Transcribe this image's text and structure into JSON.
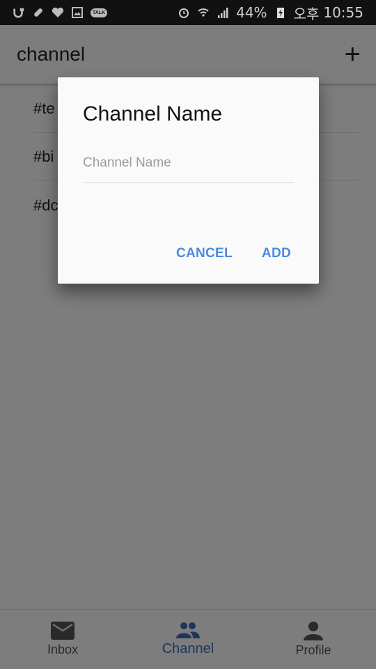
{
  "status_bar": {
    "battery": "44%",
    "time_period": "오후",
    "time": "10:55",
    "left_icons": [
      "u-plus-icon",
      "pill-icon",
      "heart-icon",
      "gallery-icon",
      "kakaotalk-icon"
    ],
    "kakaotalk_label": "TALK",
    "right_icons": [
      "alarm-icon",
      "wifi-icon",
      "signal-icon",
      "battery-charging-icon"
    ]
  },
  "appbar": {
    "title": "channel",
    "add_icon": "+"
  },
  "channels": [
    {
      "label": "#te"
    },
    {
      "label": "#bi"
    },
    {
      "label": "#dc"
    }
  ],
  "dialog": {
    "title": "Channel Name",
    "input_value": "",
    "input_placeholder": "Channel Name",
    "cancel_label": "CANCEL",
    "add_label": "ADD",
    "accent_color": "#4a8ae0"
  },
  "bottom_nav": {
    "items": [
      {
        "label": "Inbox",
        "icon": "mail-icon",
        "active": false
      },
      {
        "label": "Channel",
        "icon": "group-icon",
        "active": true
      },
      {
        "label": "Profile",
        "icon": "person-icon",
        "active": false
      }
    ],
    "active_color": "#3e6bb8"
  }
}
